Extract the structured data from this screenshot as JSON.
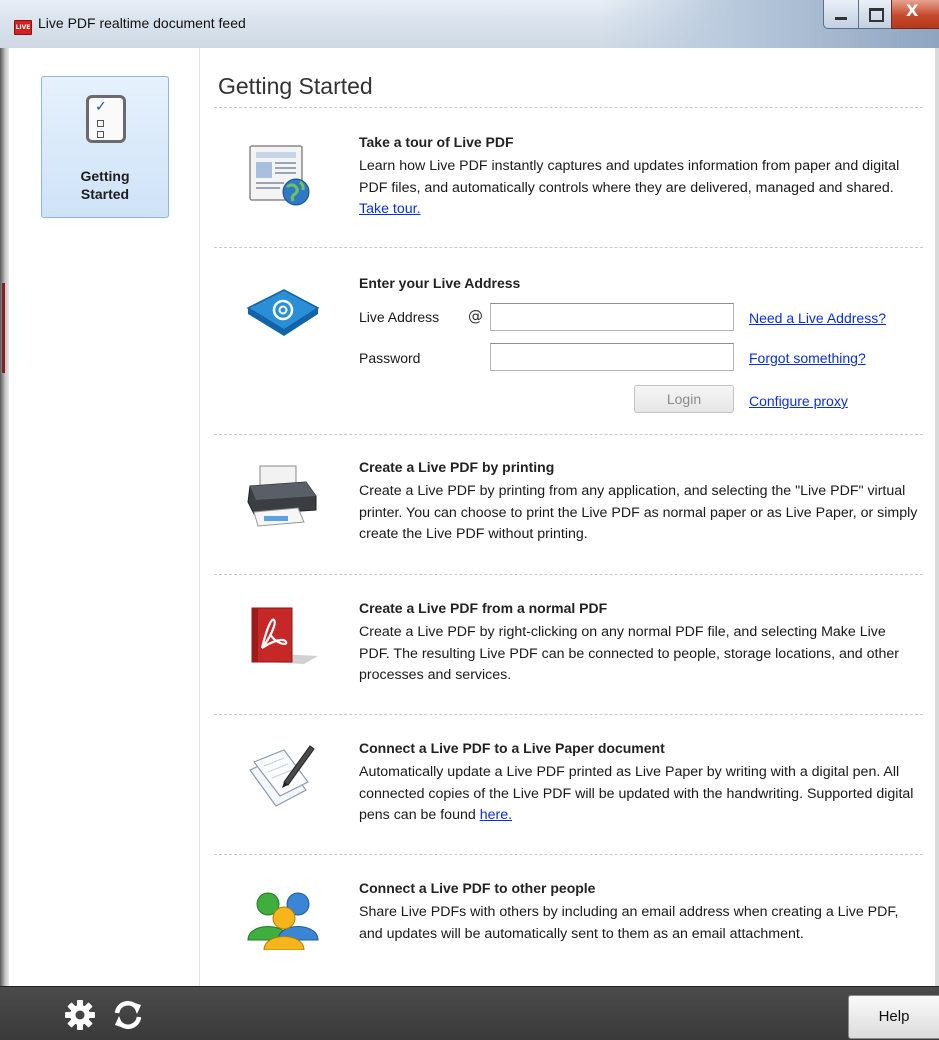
{
  "window": {
    "title": "Live PDF realtime document feed",
    "app_icon_label": "LIVE"
  },
  "sidebar": {
    "items": [
      {
        "label": "Getting\nStarted",
        "selected": true,
        "icon": "checklist-icon"
      }
    ]
  },
  "page": {
    "title": "Getting Started"
  },
  "sections": {
    "tour": {
      "icon": "document-globe-icon",
      "heading": "Take a tour of Live PDF",
      "body": "Learn how Live PDF instantly captures and updates information from paper and digital PDF files, and automatically controls where they are delivered, managed and shared.",
      "link": "Take tour."
    },
    "login": {
      "icon": "email-at-icon",
      "heading": "Enter your Live Address",
      "address_label": "Live Address",
      "at": "@",
      "address_value": "",
      "password_label": "Password",
      "password_value": "",
      "need_address_link": "Need a Live Address?",
      "forgot_link": "Forgot something?",
      "login_button": "Login",
      "proxy_link": "Configure proxy"
    },
    "print": {
      "icon": "printer-icon",
      "heading": "Create a Live PDF by printing",
      "body": "Create a Live PDF by printing from any application, and selecting the \"Live PDF\" virtual printer.  You can choose to print the Live PDF as normal paper or as Live Paper, or simply create the Live PDF without printing."
    },
    "normal_pdf": {
      "icon": "adobe-pdf-icon",
      "heading": "Create a Live PDF from a normal PDF",
      "body": "Create a Live PDF by right-clicking on any normal PDF file, and selecting Make Live PDF.  The resulting Live PDF can be connected to people, storage locations, and other processes and services."
    },
    "live_paper": {
      "icon": "paper-pen-icon",
      "heading": "Connect a Live PDF to a Live Paper document",
      "body": "Automatically update a Live PDF printed as Live Paper by writing with a digital pen. All connected copies of the Live PDF will be updated with the handwriting.  Supported digital pens can be found",
      "link": "here."
    },
    "people": {
      "icon": "people-icon",
      "heading": "Connect a Live PDF to other people",
      "body": "Share Live PDFs with others by including an email address when creating a Live PDF, and updates will be automatically sent to them as an email attachment."
    }
  },
  "bottombar": {
    "settings_icon": "gear-icon",
    "refresh_icon": "refresh-icon",
    "help_button": "Help"
  }
}
